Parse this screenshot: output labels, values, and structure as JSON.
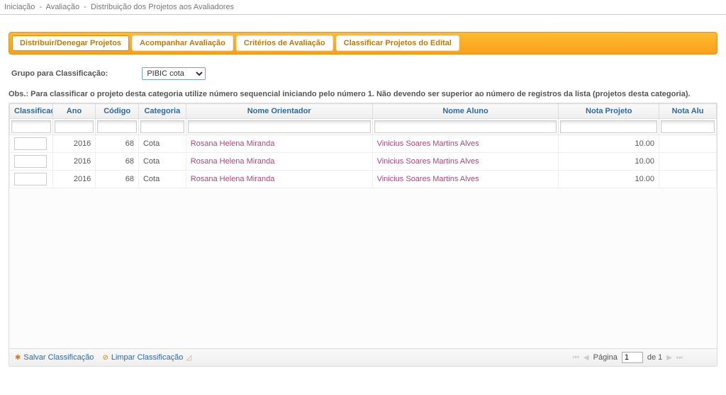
{
  "breadcrumb": [
    "Iniciação",
    "Avaliação",
    "Distribuição dos Projetos aos Avaliadores"
  ],
  "tabs": [
    {
      "label": "Distribuir/Denegar Projetos"
    },
    {
      "label": "Acompanhar Avaliação"
    },
    {
      "label": "Critérios de Avaliação"
    },
    {
      "label": "Classificar Projetos do Edital"
    }
  ],
  "group_label": "Grupo para Classificação:",
  "group_select": "PIBIC cota",
  "obs_text": "Obs.: Para classificar o projeto desta categoria utilize número sequencial iniciando pelo número 1. Não devendo ser superior ao número de registros da lista (projetos desta categoria).",
  "columns": {
    "classificacao": "Classificaç",
    "ano": "Ano",
    "codigo": "Código",
    "categoria": "Categoria",
    "orientador": "Nome Orientador",
    "aluno": "Nome Aluno",
    "nota_projeto": "Nota Projeto",
    "nota_aluno": "Nota Alu"
  },
  "rows": [
    {
      "classificacao": "",
      "ano": "2016",
      "codigo": "68",
      "categoria": "Cota",
      "orientador": "Rosana Helena Miranda",
      "aluno": "Vinicius Soares Martins Alves",
      "nota_projeto": "10.00",
      "nota_aluno": ""
    },
    {
      "classificacao": "",
      "ano": "2016",
      "codigo": "68",
      "categoria": "Cota",
      "orientador": "Rosana Helena Miranda",
      "aluno": "Vinicius Soares Martins Alves",
      "nota_projeto": "10.00",
      "nota_aluno": ""
    },
    {
      "classificacao": "",
      "ano": "2016",
      "codigo": "68",
      "categoria": "Cota",
      "orientador": "Rosana Helena Miranda",
      "aluno": "Vinicius Soares Martins Alves",
      "nota_projeto": "10.00",
      "nota_aluno": ""
    }
  ],
  "footer": {
    "salvar": "Salvar Classificação",
    "limpar": "Limpar Classificação",
    "pagina_label": "Página",
    "pagina_value": "1",
    "pagina_total": "de 1"
  }
}
